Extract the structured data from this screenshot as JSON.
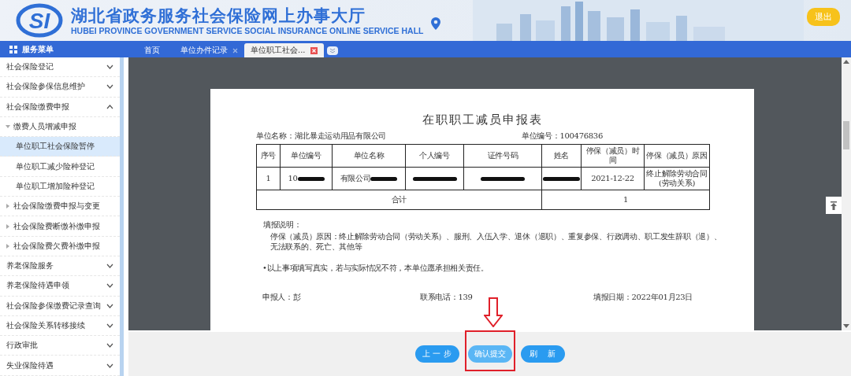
{
  "header": {
    "logo_text": "SI",
    "title": "湖北省政务服务社会保险网上办事大厅",
    "subtitle": "HUBEI PROVINCE GOVERNMENT SERVICE SOCIAL INSURANCE ONLINE SERVICE HALL",
    "logout": "退出"
  },
  "nav": {
    "menu_label": "服务菜单",
    "tabs": [
      {
        "label": "首页",
        "selected": false,
        "closable": false
      },
      {
        "label": "单位办件记录",
        "selected": false,
        "closable": true
      },
      {
        "label": "单位职工社会...",
        "selected": true,
        "closable": true
      }
    ]
  },
  "sidebar": {
    "items": [
      {
        "label": "社会保险登记",
        "expanded": false
      },
      {
        "label": "社会保险参保信息维护",
        "expanded": false
      },
      {
        "label": "社会保险缴费申报",
        "expanded": true,
        "children": [
          {
            "label": "缴费人员增减申报",
            "expanded": true,
            "children": [
              {
                "label": "单位职工社会保险暂停",
                "selected": true
              },
              {
                "label": "单位职工减少险种登记",
                "selected": false
              },
              {
                "label": "单位职工增加险种登记",
                "selected": false
              }
            ]
          },
          {
            "label": "社会保险缴费申报与变更",
            "expanded": false
          },
          {
            "label": "社会保险费断缴补缴申报",
            "expanded": false
          },
          {
            "label": "社会保险费欠费补缴申报",
            "expanded": false
          }
        ]
      },
      {
        "label": "养老保险服务",
        "expanded": false
      },
      {
        "label": "养老保险待遇申领",
        "expanded": false
      },
      {
        "label": "社会保险参保缴费记录查询",
        "expanded": false
      },
      {
        "label": "社会保险关系转移接续",
        "expanded": false
      },
      {
        "label": "行政审批",
        "expanded": false
      },
      {
        "label": "失业保险待遇",
        "expanded": false
      }
    ]
  },
  "document": {
    "title": "在职职工减员申报表",
    "unit_name": "单位名称：湖北暴走运动用品有限公司",
    "unit_code": "单位编号：100476836",
    "table": {
      "columns": [
        "序号",
        "单位编号",
        "单位名称",
        "个人编号",
        "证件号码",
        "姓名",
        "停保（减员）时间",
        "停保（减员）原因"
      ],
      "rows": [
        [
          {
            "text": "1",
            "redacted": false
          },
          {
            "text": "10",
            "redacted": true
          },
          {
            "text": "有限公司",
            "redacted": true
          },
          {
            "redacted": true
          },
          {
            "redacted": true
          },
          {
            "redacted": true
          },
          {
            "text": "2021-12-22",
            "redacted": false
          },
          {
            "text": "终止解除劳动合同(劳动关系)",
            "redacted": false
          }
        ]
      ],
      "total": {
        "label": "合计",
        "value": "1"
      }
    },
    "notes_title": "填报说明：",
    "notes": "停保（减员）原因：终止解除劳动合同（劳动关系）、服刑、入伍入学、退休（退职）、重复参保、行政调动、职工发生辞职（退）、无法联系的、死亡、其他等",
    "declaration": "•以上事项填写真实，若与实际情况不符，本单位愿承担相关责任。",
    "signature": [
      "申报人：彭",
      "联系电话：139",
      "填报日期：2022年01月23日"
    ]
  },
  "buttons": [
    {
      "label": "上 一 步",
      "highlighted": false
    },
    {
      "label": "确认提交",
      "highlighted": true
    },
    {
      "label": "刷　 新",
      "highlighted": false
    }
  ]
}
